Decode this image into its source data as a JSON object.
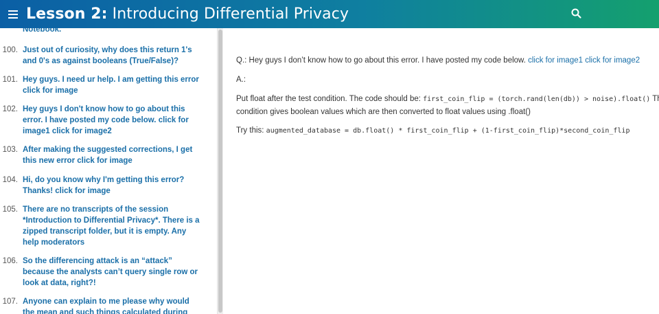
{
  "header": {
    "title_prefix": "Lesson 2:",
    "title_rest": "Introducing Differential Privacy"
  },
  "sidebar": {
    "partial_top": "Notebook.",
    "items": [
      {
        "num": "100.",
        "text": "Just out of curiosity, why does this return 1's and 0's as against booleans (True/False)?"
      },
      {
        "num": "101.",
        "text": "Hey guys. I need ur help. I am getting this error click for image"
      },
      {
        "num": "102.",
        "text": "Hey guys I don't know how to go about this error. I have posted my code below. click for image1 click for image2"
      },
      {
        "num": "103.",
        "text": "After making the suggested corrections, I get this new error click for image"
      },
      {
        "num": "104.",
        "text": "Hi, do you know why I'm getting this error? Thanks! click for image"
      },
      {
        "num": "105.",
        "text": "There are no transcripts of the session *Introduction to Differential Privacy*. There is a zipped transcript folder, but it is empty. Any help moderators"
      },
      {
        "num": "106.",
        "text": "So the differencing attack is an “attack” because the analysts can’t query single row or look at data, right?!"
      },
      {
        "num": "107.",
        "text": "Anyone can explain to me please why would the mean and such things calculated during the first"
      }
    ]
  },
  "content": {
    "question_label": "Q.:",
    "question_text": "Hey guys I don’t know how to go about this error. I have posted my code below.",
    "link1": "click for image1",
    "link2": "click for image2",
    "answer_label": "A.:",
    "answer_p1_text": "Put float after the test condition. The code should be:",
    "answer_p1_code": "first_coin_flip = (torch.rand(len(db)) > noise).float()",
    "answer_p1_tail": "The test",
    "answer_p2_text": "condition gives boolean values which are then converted to float values using .float()",
    "try_text": "Try this:",
    "try_code": "augmented_database = db.float() * first_coin_flip + (1-first_coin_flip)*second_coin_flip"
  },
  "icons": {
    "menu": "hamburger-menu-icon",
    "search": "search-icon"
  }
}
